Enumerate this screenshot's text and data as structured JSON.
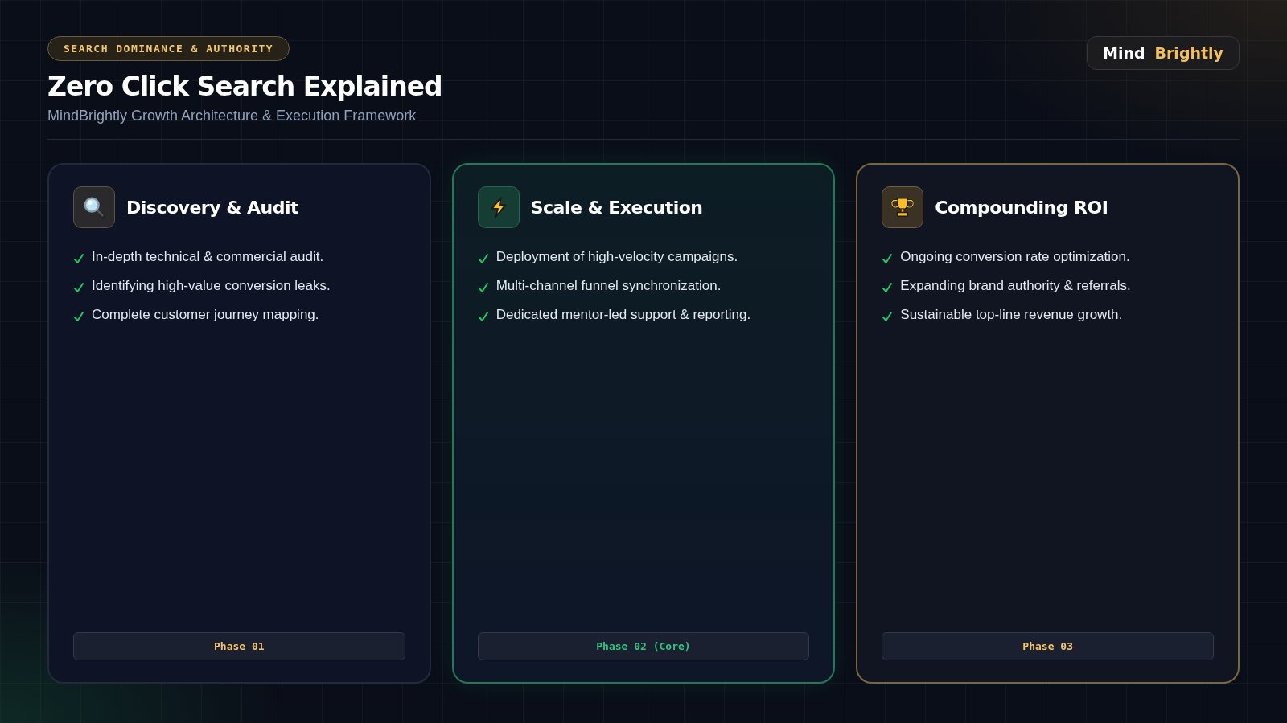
{
  "header": {
    "eyebrow": "SEARCH DOMINANCE & AUTHORITY",
    "title": "Zero Click Search Explained",
    "subtitle": "MindBrightly Growth Architecture & Execution Framework"
  },
  "logo": [
    "Mind",
    "Brightly"
  ],
  "cards": [
    {
      "kind": "plain",
      "title": "Discovery & Audit",
      "points": [
        "In-depth technical & commercial audit.",
        "Identifying high-value conversion leaks.",
        "Complete customer journey mapping."
      ],
      "phase": "Phase 01"
    },
    {
      "kind": "core",
      "title": "Scale & Execution",
      "points": [
        "Deployment of high-velocity campaigns.",
        "Multi-channel funnel synchronization.",
        "Dedicated mentor-led support & reporting."
      ],
      "phase": "Phase 02 (Core)"
    },
    {
      "kind": "gold",
      "title": "Compounding ROI",
      "points": [
        "Ongoing conversion rate optimization.",
        "Expanding brand authority & referrals.",
        "Sustainable top-line revenue growth."
      ],
      "phase": "Phase 03"
    }
  ]
}
